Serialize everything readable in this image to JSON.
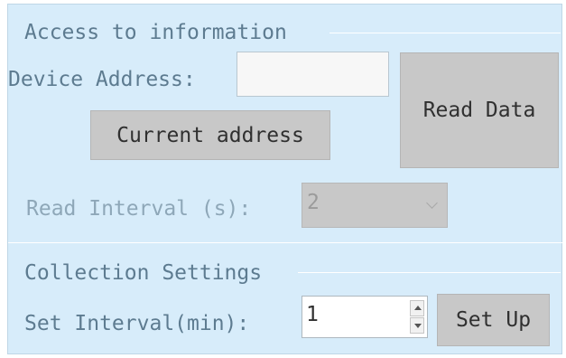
{
  "access_group": {
    "title": "Access to information",
    "device_address_label": "Device Address:",
    "device_address_value": "",
    "current_address_button": "Current address",
    "read_data_button": "Read Data",
    "read_interval_label": "Read Interval (s):",
    "read_interval_value": "2"
  },
  "collection_group": {
    "title": "Collection Settings",
    "set_interval_label": "Set Interval(min):",
    "set_interval_value": "1",
    "set_up_button": "Set Up"
  },
  "icons": {
    "dropdown": "chevron-down-icon",
    "spin_up": "spin-up-arrow-icon",
    "spin_down": "spin-down-arrow-icon"
  },
  "colors": {
    "panel_background": "#d7ecfa",
    "button_background": "#c8c8c8",
    "label_text": "#5d7b90",
    "disabled_text": "#8ea7b8"
  }
}
